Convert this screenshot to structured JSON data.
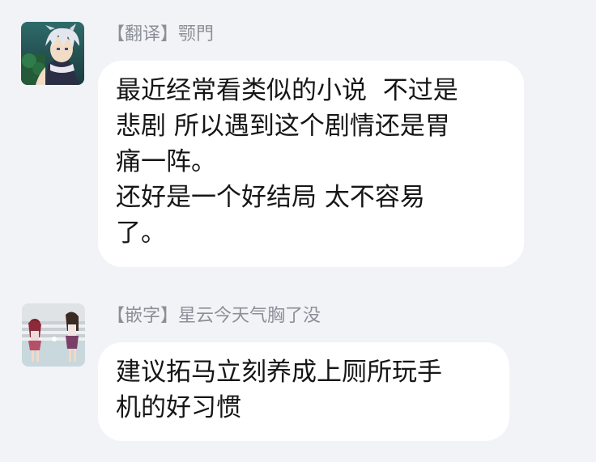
{
  "messages": [
    {
      "sender": "【翻译】颚門",
      "text": "最近经常看类似的小说  不过是\n悲剧 所以遇到这个剧情还是胃\n痛一阵。\n还好是一个好结局 太不容易\n了。"
    },
    {
      "sender": "【嵌字】星云今天气胸了没",
      "text": "建议拓马立刻养成上厕所玩手\n机的好习惯"
    }
  ],
  "colors": {
    "background": "#f2f3f7",
    "bubble": "#ffffff",
    "sender_text": "#8b8f97",
    "message_text": "#161616"
  }
}
